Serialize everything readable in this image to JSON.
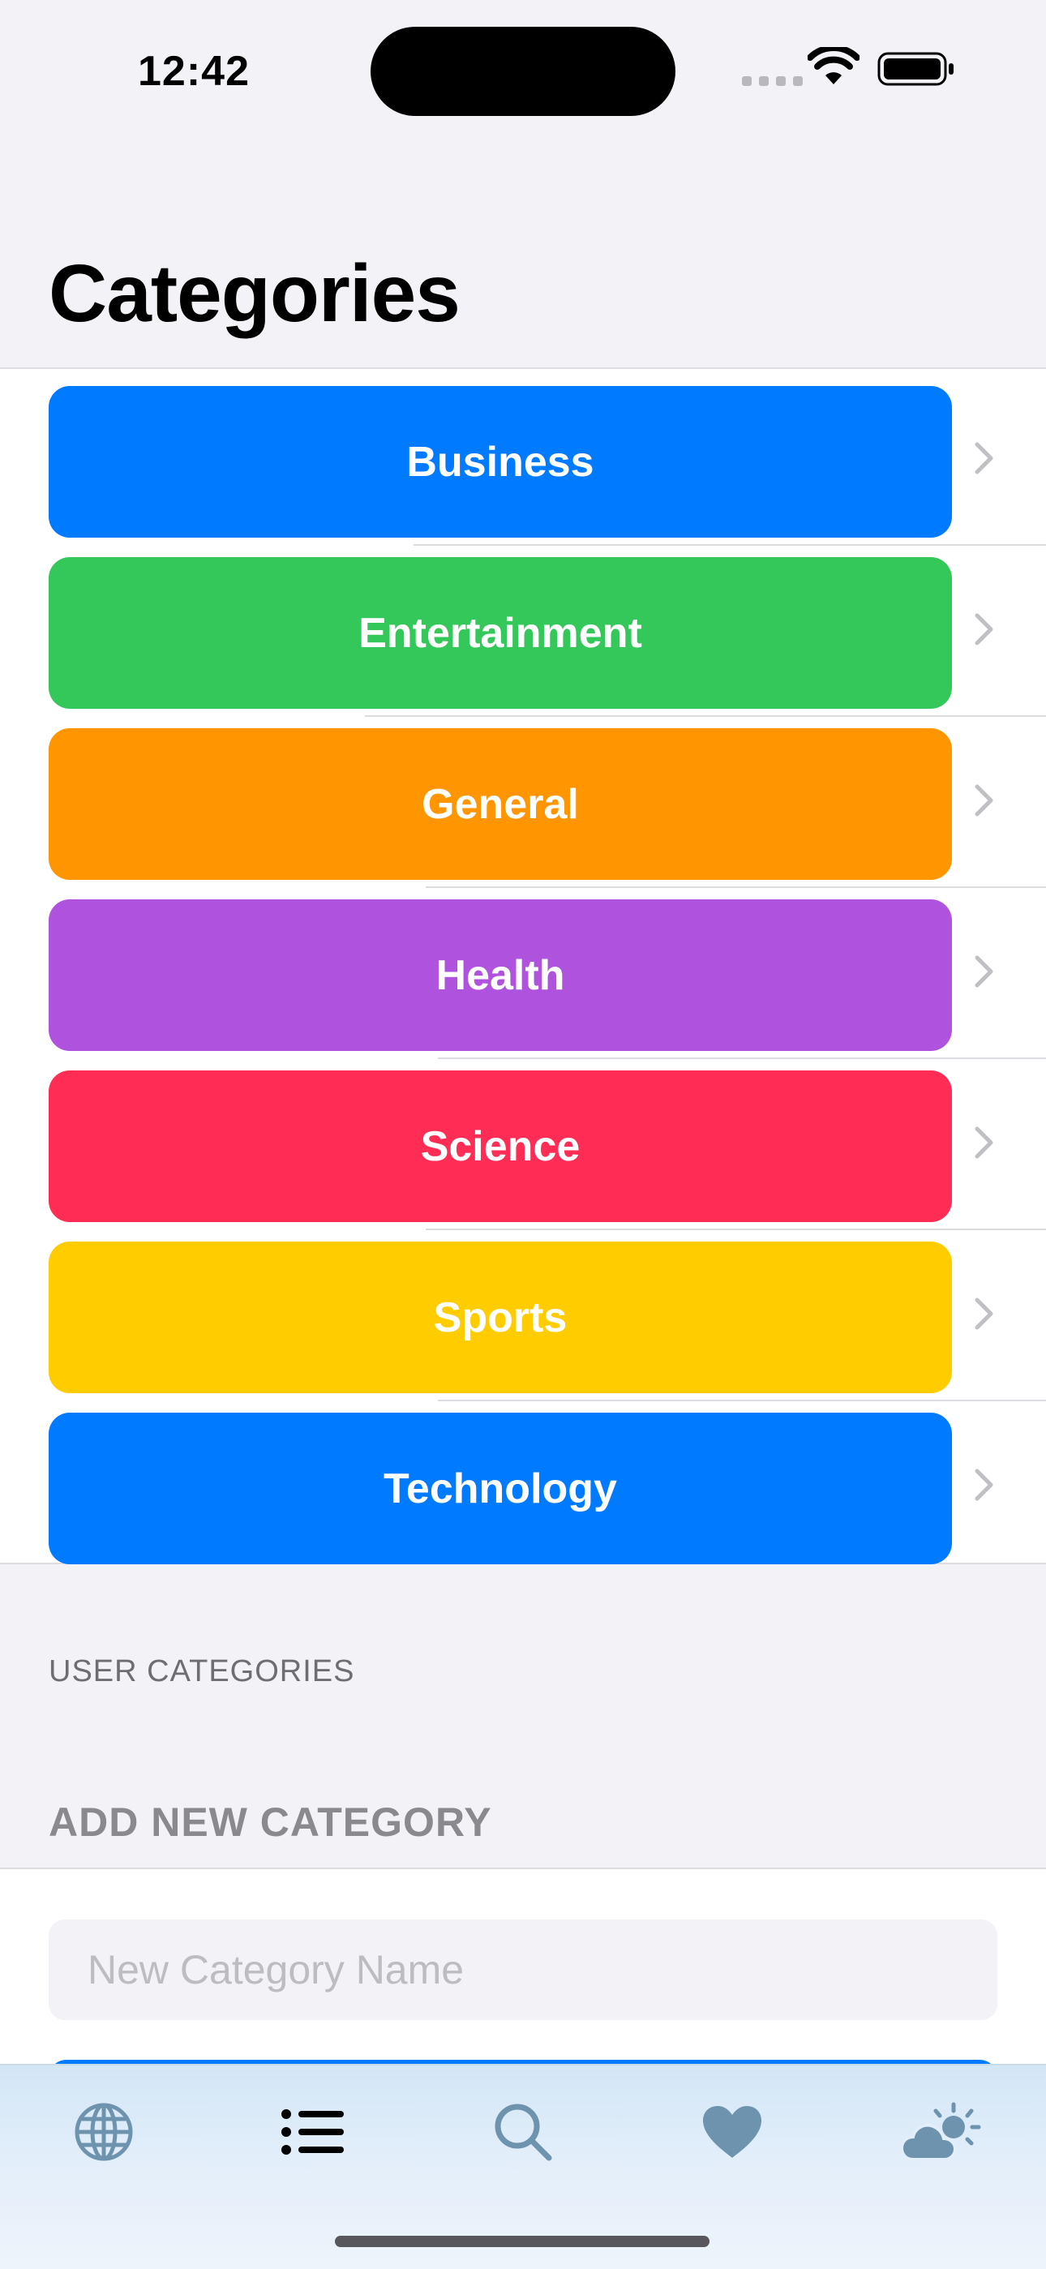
{
  "status_bar": {
    "time": "12:42"
  },
  "page": {
    "title": "Categories"
  },
  "categories": [
    {
      "label": "Business",
      "color": "#007aff"
    },
    {
      "label": "Entertainment",
      "color": "#34c759"
    },
    {
      "label": "General",
      "color": "#ff9500"
    },
    {
      "label": "Health",
      "color": "#af52de"
    },
    {
      "label": "Science",
      "color": "#ff2d55"
    },
    {
      "label": "Sports",
      "color": "#ffcc00"
    },
    {
      "label": "Technology",
      "color": "#007aff"
    }
  ],
  "user_section": {
    "label": "USER CATEGORIES"
  },
  "add_section": {
    "header": "ADD NEW CATEGORY",
    "input_placeholder": "New Category Name",
    "input_value": "",
    "button_color": "#007aff"
  },
  "tab_bar": {
    "tint": "#6e93ae",
    "active_color": "#000000",
    "tabs": [
      {
        "icon": "globe-icon",
        "active": false
      },
      {
        "icon": "list-icon",
        "active": true
      },
      {
        "icon": "search-icon",
        "active": false
      },
      {
        "icon": "heart-icon",
        "active": false
      },
      {
        "icon": "cloud-sun-icon",
        "active": false
      }
    ]
  }
}
